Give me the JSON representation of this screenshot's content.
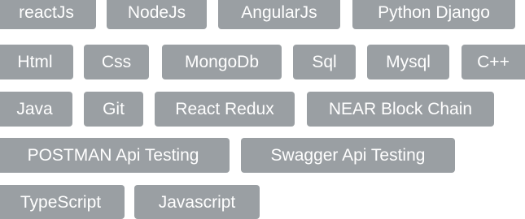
{
  "skills": [
    "reactJs",
    "NodeJs",
    "AngularJs",
    "Python Django",
    "Html",
    "Css",
    "MongoDb",
    "Sql",
    "Mysql",
    "C++",
    "Java",
    "Git",
    "React Redux",
    "NEAR Block Chain",
    "POSTMAN Api Testing",
    "Swagger Api Testing",
    "TypeScript",
    "Javascript"
  ],
  "colors": {
    "tag_background": "#9a9fa3",
    "tag_text": "#ffffff"
  }
}
